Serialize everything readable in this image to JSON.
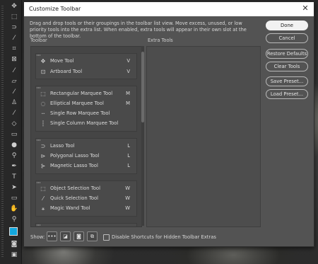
{
  "dialog": {
    "title": "Customize Toolbar",
    "close_icon": "close-icon",
    "description": "Drag and drop tools or their groupings in the toolbar list view. Move excess, unused, or low priority tools into the extra list. When enabled, extra tools will appear in their own slot at the bottom of the toolbar.",
    "toolbar_heading": "Toolbar",
    "extra_heading": "Extra Tools"
  },
  "tool_groups": [
    {
      "items": [
        {
          "icon": "move-icon",
          "label": "Move Tool",
          "key": "V"
        },
        {
          "icon": "artboard-icon",
          "label": "Artboard Tool",
          "key": "V"
        }
      ]
    },
    {
      "items": [
        {
          "icon": "rect-marquee-icon",
          "label": "Rectangular Marquee Tool",
          "key": "M"
        },
        {
          "icon": "ellipse-marquee-icon",
          "label": "Elliptical Marquee Tool",
          "key": "M"
        },
        {
          "icon": "row-marquee-icon",
          "label": "Single Row Marquee Tool",
          "key": ""
        },
        {
          "icon": "column-marquee-icon",
          "label": "Single Column Marquee Tool",
          "key": ""
        }
      ]
    },
    {
      "items": [
        {
          "icon": "lasso-icon",
          "label": "Lasso Tool",
          "key": "L"
        },
        {
          "icon": "polygonal-lasso-icon",
          "label": "Polygonal Lasso Tool",
          "key": "L"
        },
        {
          "icon": "magnetic-lasso-icon",
          "label": "Magnetic Lasso Tool",
          "key": "L"
        }
      ]
    },
    {
      "items": [
        {
          "icon": "object-selection-icon",
          "label": "Object Selection Tool",
          "key": "W"
        },
        {
          "icon": "quick-selection-icon",
          "label": "Quick Selection Tool",
          "key": "W"
        },
        {
          "icon": "magic-wand-icon",
          "label": "Magic Wand Tool",
          "key": "W"
        }
      ]
    }
  ],
  "buttons": {
    "done": "Done",
    "cancel": "Cancel",
    "restore_defaults": "Restore Defaults",
    "clear_tools": "Clear Tools",
    "save_preset": "Save Preset...",
    "load_preset": "Load Preset..."
  },
  "footer": {
    "show_label": "Show:",
    "show_options": [
      "more-icon",
      "swap-colors-icon",
      "quick-mask-icon",
      "screen-mode-icon"
    ],
    "disable_shortcuts_label": "Disable Shortcuts for Hidden Toolbar Extras",
    "disable_shortcuts_checked": false
  },
  "left_toolbar": {
    "tools": [
      "move-icon",
      "rect-marquee-icon",
      "lasso-icon",
      "quick-selection-icon",
      "crop-icon",
      "frame-icon",
      "eyedropper-icon",
      "healing-brush-icon",
      "brush-icon",
      "clone-stamp-icon",
      "history-brush-icon",
      "eraser-icon",
      "gradient-icon",
      "blur-icon",
      "dodge-icon",
      "pen-icon",
      "type-icon",
      "path-selection-icon",
      "rectangle-icon",
      "hand-icon",
      "zoom-icon",
      "more-icon"
    ],
    "foreground_color": "#13a7dd",
    "background_color": "#ffffff"
  }
}
